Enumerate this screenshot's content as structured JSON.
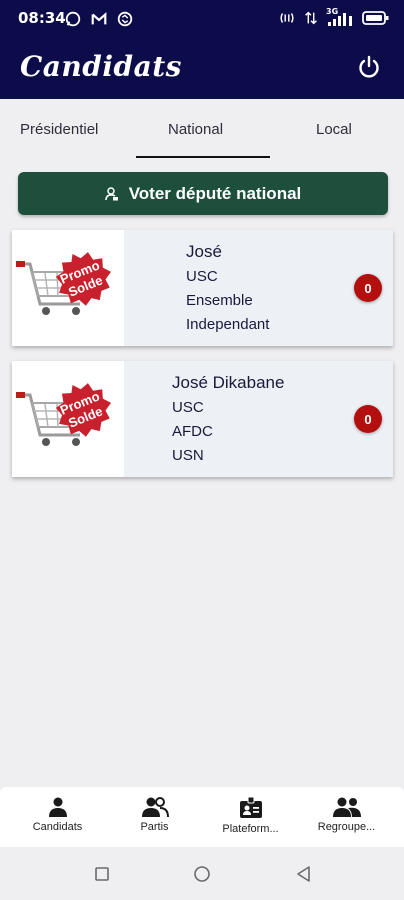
{
  "status_bar": {
    "time": "08:34",
    "left_icons": [
      "whatsapp-icon",
      "gmail-icon",
      "sync-icon"
    ],
    "right_icons": [
      "nfc-icon",
      "data-icon",
      "signal-icon",
      "battery-icon"
    ],
    "network_label": "3G"
  },
  "app_bar": {
    "title": "Candidats",
    "power_icon": "power-icon"
  },
  "tabs": [
    {
      "label": "Présidentiel"
    },
    {
      "label": "National",
      "selected": true
    },
    {
      "label": "Local"
    }
  ],
  "vote_button": {
    "label": "Voter député national",
    "icon": "user-lock-icon"
  },
  "candidates": [
    {
      "name": "José",
      "lines": [
        "USC",
        "Ensemble",
        "Independant"
      ],
      "count": "0",
      "image_text": [
        "Promo",
        "Solde"
      ]
    },
    {
      "name": "José Dikabane",
      "lines": [
        "USC",
        "AFDC",
        "USN"
      ],
      "count": "0",
      "image_text": [
        "Promo",
        "Solde"
      ]
    }
  ],
  "bottom_nav": [
    {
      "label": "Candidats",
      "icon": "person-icon"
    },
    {
      "label": "Partis",
      "icon": "people-icon"
    },
    {
      "label": "Plateform...",
      "icon": "id-badge-icon"
    },
    {
      "label": "Regroupe...",
      "icon": "group-icon"
    }
  ],
  "colors": {
    "app_bar": "#0c0c4a",
    "vote_button": "#1e4f3c",
    "badge": "#b30f0f",
    "background": "#efeef0"
  }
}
